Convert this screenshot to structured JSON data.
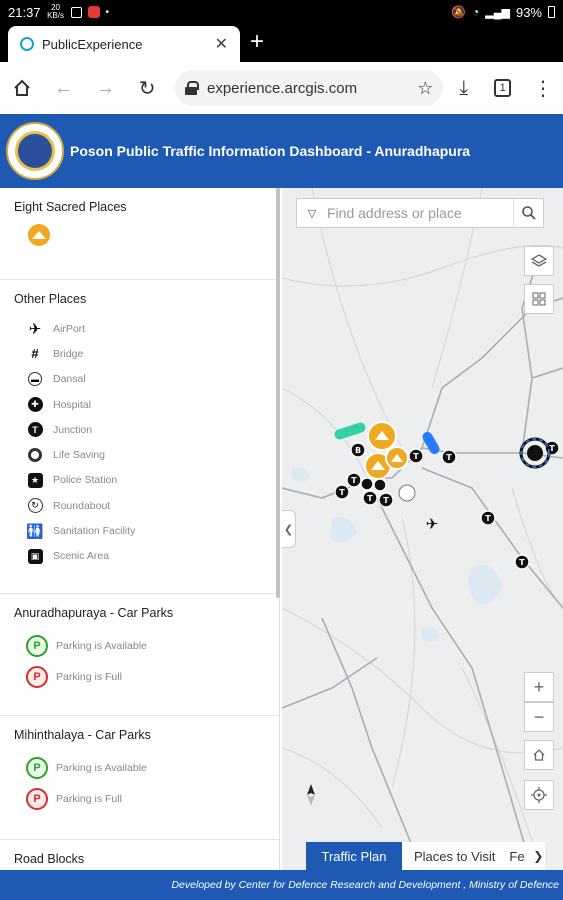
{
  "status_bar": {
    "time": "21:37",
    "mini_text": "20 KB/s",
    "battery": "93%"
  },
  "browser": {
    "tab_title": "PublicExperience",
    "url": "experience.arcgis.com",
    "tab_count": "1",
    "icons": [
      "home-icon",
      "back-icon",
      "forward-icon",
      "reload-icon",
      "lock-icon",
      "star-icon",
      "download-icon",
      "menu-icon"
    ]
  },
  "header": {
    "title": "Poson Public Traffic Information Dashboard - Anuradhapura"
  },
  "legend": {
    "sacred": {
      "title": "Eight Sacred Places"
    },
    "other": {
      "title": "Other Places",
      "items": [
        {
          "label": "AirPort",
          "icon": "airport-icon"
        },
        {
          "label": "Bridge",
          "icon": "bridge-icon"
        },
        {
          "label": "Dansal",
          "icon": "dansal-icon"
        },
        {
          "label": "Hospital",
          "icon": "hospital-icon"
        },
        {
          "label": "Junction",
          "icon": "junction-icon"
        },
        {
          "label": "Life Saving",
          "icon": "life-saving-icon"
        },
        {
          "label": "Police Station",
          "icon": "police-station-icon"
        },
        {
          "label": "Roundabout",
          "icon": "roundabout-icon"
        },
        {
          "label": "Sanitation Facility",
          "icon": "sanitation-icon"
        },
        {
          "label": "Scenic Area",
          "icon": "scenic-area-icon"
        }
      ]
    },
    "anuradhapura": {
      "title": "Anuradhapuraya - Car Parks",
      "available": "Parking is Available",
      "full": "Parking is Full"
    },
    "mihinthalaya": {
      "title": "Mihinthalaya - Car Parks",
      "available": "Parking is Available",
      "full": "Parking is Full"
    },
    "road_blocks": {
      "title": "Road Blocks"
    }
  },
  "map": {
    "search_placeholder": "Find address or place",
    "parking_glyph": "P",
    "tabs": [
      "Traffic Plan",
      "Places to Visit",
      "Fe"
    ],
    "colors": {
      "accent": "#1e5ab3",
      "stupa": "#f0a820"
    }
  },
  "footer": {
    "text": "Developed by Center for Defence Research and Development , Ministry of Defence"
  }
}
